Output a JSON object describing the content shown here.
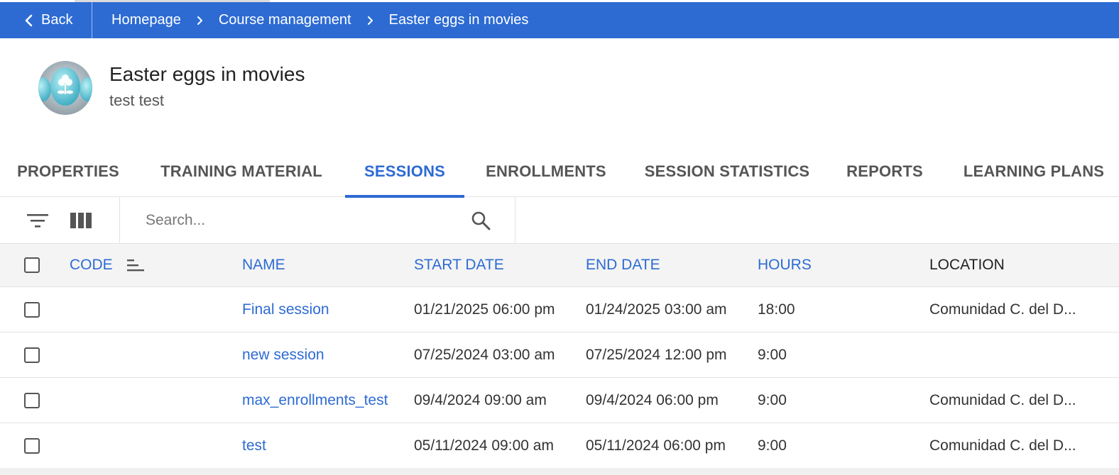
{
  "topbar": {
    "back_label": "Back",
    "breadcrumb": [
      "Homepage",
      "Course management",
      "Easter eggs in movies"
    ]
  },
  "course": {
    "title": "Easter eggs in movies",
    "subtitle": "test test"
  },
  "tabs": [
    {
      "label": "PROPERTIES"
    },
    {
      "label": "TRAINING MATERIAL"
    },
    {
      "label": "SESSIONS",
      "active": true
    },
    {
      "label": "ENROLLMENTS"
    },
    {
      "label": "SESSION STATISTICS"
    },
    {
      "label": "REPORTS"
    },
    {
      "label": "LEARNING PLANS"
    }
  ],
  "toolbar": {
    "filter_icon": "filter-icon",
    "columns_icon": "columns-icon",
    "search_placeholder": "Search...",
    "search_icon": "search-icon"
  },
  "table": {
    "headers": {
      "code": "CODE",
      "name": "NAME",
      "start_date": "START DATE",
      "end_date": "END DATE",
      "hours": "HOURS",
      "location": "LOCATION"
    },
    "rows": [
      {
        "code": "",
        "name": "Final session",
        "start_date": "01/21/2025 06:00 pm",
        "end_date": "01/24/2025 03:00 am",
        "hours": "18:00",
        "location": "Comunidad C. del D..."
      },
      {
        "code": "",
        "name": "new session",
        "start_date": "07/25/2024 03:00 am",
        "end_date": "07/25/2024 12:00 pm",
        "hours": "9:00",
        "location": ""
      },
      {
        "code": "",
        "name": "max_enrollments_test",
        "start_date": "09/4/2024 09:00 am",
        "end_date": "09/4/2024 06:00 pm",
        "hours": "9:00",
        "location": "Comunidad C. del D..."
      },
      {
        "code": "",
        "name": "test",
        "start_date": "05/11/2024 09:00 am",
        "end_date": "05/11/2024 06:00 pm",
        "hours": "9:00",
        "location": "Comunidad C. del D..."
      }
    ]
  },
  "colors": {
    "accent": "#2d6bd3",
    "header_bg": "#f4f4f4",
    "border": "#e2e2e2"
  }
}
